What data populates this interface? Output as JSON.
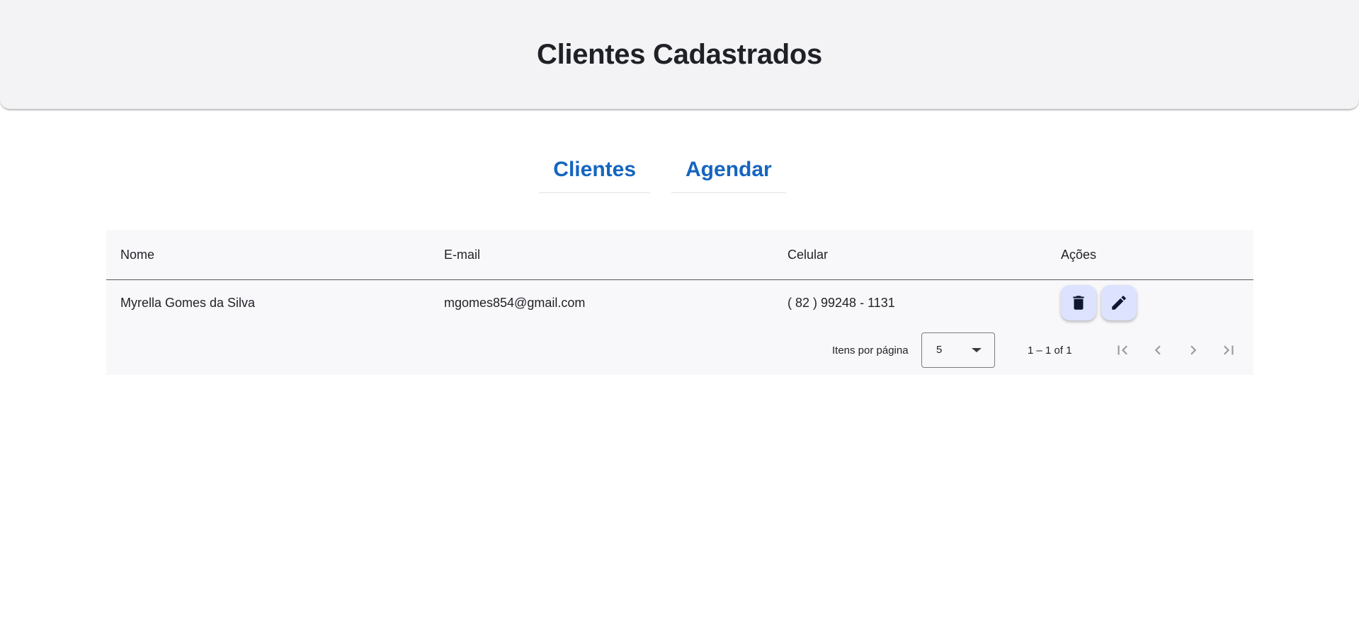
{
  "header": {
    "title": "Clientes Cadastrados"
  },
  "nav": {
    "items": [
      {
        "label": "Clientes"
      },
      {
        "label": "Agendar"
      }
    ]
  },
  "table": {
    "columns": {
      "nome": "Nome",
      "email": "E-mail",
      "celular": "Celular",
      "acoes": "Ações"
    },
    "rows": [
      {
        "nome": "Myrella Gomes da Silva",
        "email": "mgomes854@gmail.com",
        "celular": "( 82 ) 99248 - 1131"
      }
    ],
    "actions": {
      "delete_icon": "trash-icon",
      "edit_icon": "pencil-icon"
    }
  },
  "paginator": {
    "items_label": "Itens por página",
    "page_size": "5",
    "range": "1 – 1 of 1"
  },
  "colors": {
    "accent": "#1565c0",
    "action_button_bg": "#dde3ff",
    "header_bg": "#f3f3f5"
  }
}
